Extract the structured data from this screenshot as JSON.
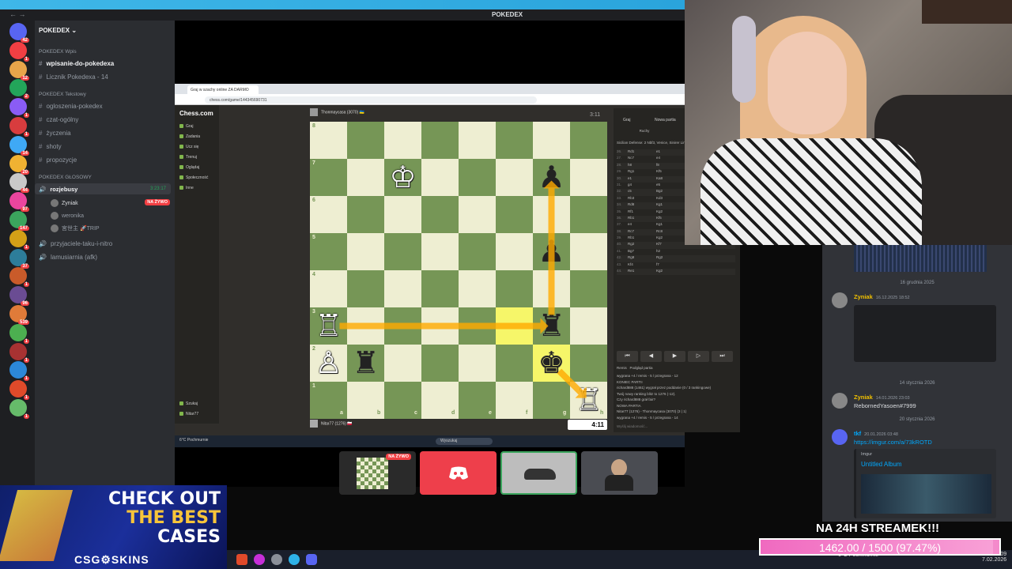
{
  "window": {
    "title": "POKEDEX",
    "nav": "←  →"
  },
  "server": {
    "name": "POKEDEX",
    "badges": [
      "42",
      "1",
      "12",
      "2",
      "1",
      "1",
      "14",
      "20",
      "44",
      "97",
      "147",
      "1",
      "37",
      "1",
      "96",
      "539",
      "1",
      "1",
      "1",
      "1",
      "1"
    ],
    "categories": {
      "wpis": "POKEDEX Wpis",
      "tekstowy": "POKEDEX Tekstowy",
      "glosowy": "POKEDEX GŁOSOWY"
    },
    "channels_wpis": [
      "wpisanie-do-pokedexa",
      "Licznik Pokedexa - 14"
    ],
    "channels_text": [
      "ogloszenia-pokedex",
      "czat-ogólny",
      "życzenia",
      "shoty",
      "propozycje"
    ],
    "voice_channel": {
      "name": "rozjebusy",
      "timer": "3:23:17"
    },
    "voice_users": [
      {
        "name": "Zyniak",
        "status": "NA ŻYWO"
      },
      {
        "name": "weronika",
        "status": ""
      },
      {
        "name": "宮世主 🚀TRIP",
        "status": ""
      }
    ],
    "channels_after": [
      "przyjaciele-taku-i-nitro",
      "lamusiarnia (afk)"
    ]
  },
  "browser": {
    "tab": "Graj w szachy online ZA DARMO",
    "url": "chess.com/game/144345690731"
  },
  "chesscom": {
    "logo": "Chess.com",
    "menu": [
      "Graj",
      "Zadania",
      "Ucz się",
      "Trenuj",
      "Oglądaj",
      "Społeczność",
      "Inne"
    ],
    "bottom_menu": [
      "Szukaj",
      "Nitar77"
    ],
    "top_player": "Thonmaycasa (3070) 🇺🇦",
    "top_clock": "3:11",
    "bottom_player": "Nitar77 (1276) 🇵🇱",
    "bottom_clock": "4:11",
    "ranks": [
      "8",
      "7",
      "6",
      "5",
      "4",
      "3",
      "2",
      "1"
    ],
    "files": [
      "a",
      "b",
      "c",
      "d",
      "e",
      "f",
      "g",
      "h"
    ],
    "pieces": [
      {
        "square": "c7",
        "glyph": "♔",
        "color": "w",
        "name": "white-king"
      },
      {
        "square": "a3",
        "glyph": "♖",
        "color": "w",
        "name": "white-rook"
      },
      {
        "square": "a2",
        "glyph": "♙",
        "color": "w",
        "name": "white-pawn"
      },
      {
        "square": "h1",
        "glyph": "♖",
        "color": "w",
        "name": "white-rook-h1"
      },
      {
        "square": "b2",
        "glyph": "♜",
        "color": "b",
        "name": "black-rook"
      },
      {
        "square": "g3",
        "glyph": "♜",
        "color": "b",
        "name": "black-rook-g3"
      },
      {
        "square": "g7",
        "glyph": "♟",
        "color": "b",
        "name": "black-pawn-g7"
      },
      {
        "square": "g5",
        "glyph": "♟",
        "color": "b",
        "name": "black-pawn-g5"
      },
      {
        "square": "g2",
        "glyph": "♚",
        "color": "b",
        "name": "black-king"
      }
    ],
    "highlights": [
      "f3",
      "g2"
    ],
    "panel_tabs": [
      "Graj",
      "Nowa partia"
    ],
    "moves_label": "Ruchy",
    "opening": "Sicilian Defense: 2 Nbf3, Venice, Sinirer Line",
    "moves": [
      "Rd1",
      "e1",
      "Nc7",
      "e4",
      "h8",
      "f8",
      "Rg1",
      "Kf5",
      "e1",
      "Ka8",
      "g4",
      "e5",
      "c5",
      "Bg2",
      "Rb3",
      "Kd3",
      "Rd8",
      "Kg1",
      "Rf1",
      "Kg2",
      "Rb1",
      "Kf5",
      "e4",
      "Kg1",
      "Rc7",
      "Rc8",
      "Rb1",
      "Kg2",
      "Rg2",
      "Kf7",
      "Bg7",
      "h2",
      "Rg8",
      "Rg2",
      "Kf4",
      "f7",
      "Re1",
      "Kg2"
    ],
    "controls": [
      "⏮",
      "◀",
      "▶",
      "▷",
      "⏭"
    ],
    "panel_links": [
      "Remis",
      "Podgląd partia"
    ],
    "result_lines": [
      "wygrana +4 / remis - 5 / przegrana - 12",
      "KONIEC PARTII",
      "richard888 (1461) wygrał przez poddanie (0 / 3 rankingowe)",
      "Twój nowy ranking blitz to 1276 (-12).",
      "Czy richard888 grał fair?",
      "NOWA PARTIA",
      "Nitar77 (1276) - Thonmaycasa (3070) (3 | 1)",
      "wygrana +4 / remis - 5 / przegrana - 14"
    ],
    "input_placeholder": "Wyślij wiadomość..."
  },
  "win_taskbar": {
    "search": "Wyszukaj",
    "weather": "6°C Pochmurnie"
  },
  "tiles": [
    {
      "label": "NA ŻYWO",
      "name": "chess-stream-tile"
    },
    {
      "label": "",
      "name": "discord-tile"
    },
    {
      "label": "",
      "name": "car-video-tile"
    },
    {
      "label": "",
      "name": "person-video-tile"
    }
  ],
  "chat": {
    "dates": [
      "16 grudnia 2025",
      "14 stycznia 2026",
      "20 stycznia 2026"
    ],
    "messages": [
      {
        "author": "Zyniak",
        "time": "16.12.2025 18:52",
        "text": ""
      },
      {
        "author": "Zyniak",
        "time": "14.01.2026 23:03",
        "text": "RebornedYasoen#7999"
      },
      {
        "author": "tkf",
        "time": "20.01.2026 03:48",
        "text": "https://imgur.com/a/73kROTD"
      }
    ],
    "embed_provider": "Imgur",
    "embed_title": "Untitled Album"
  },
  "promo": {
    "line1": "CHECK OUT",
    "line2": "THE BEST",
    "line3": "CASES",
    "brand": "CSG⚙SKINS"
  },
  "goal": {
    "label": "NA 24H STREAMEK!!!",
    "text": "1462.00 / 1500 (97.47%)",
    "fraction": 0.9747
  },
  "clock": {
    "time": "20:09",
    "date": "7.02.2026",
    "weather": "6°C Pochmurnie"
  }
}
